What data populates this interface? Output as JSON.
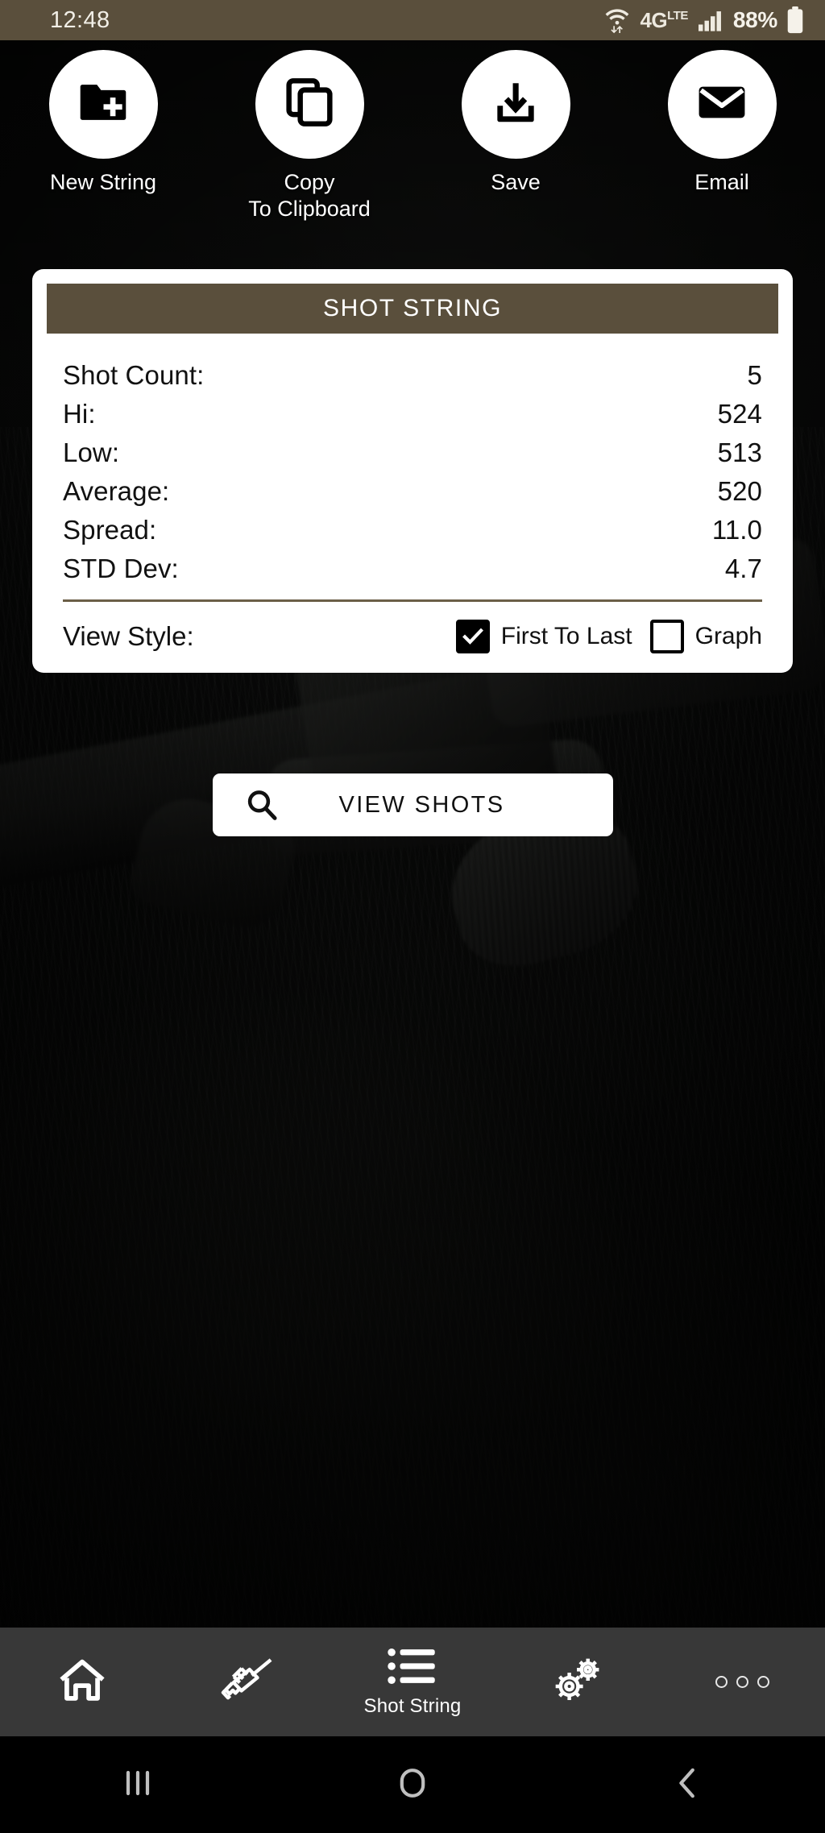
{
  "status_bar": {
    "time": "12:48",
    "wifi_icon": "wifi-with-transfer-arrows-icon",
    "network_label": "4G",
    "network_suffix": "LTE",
    "signal_icon": "signal-bars-icon",
    "battery_percent": "88%",
    "battery_icon": "battery-icon",
    "background_color": "#5A4F3C"
  },
  "actions": [
    {
      "label": "New String",
      "icon": "folder-plus-icon"
    },
    {
      "label": "Copy\nTo Clipboard",
      "label_line1": "Copy",
      "label_line2": "To Clipboard",
      "icon": "copy-icon"
    },
    {
      "label": "Save",
      "icon": "download-icon"
    },
    {
      "label": "Email",
      "icon": "envelope-icon"
    }
  ],
  "card": {
    "header_title": "SHOT STRING",
    "header_color": "#5A4F3C",
    "stats": [
      {
        "key": "Shot Count:",
        "value": "5"
      },
      {
        "key": "Hi:",
        "value": "524"
      },
      {
        "key": "Low:",
        "value": "513"
      },
      {
        "key": "Average:",
        "value": "520"
      },
      {
        "key": "Spread:",
        "value": "11.0"
      },
      {
        "key": "STD Dev:",
        "value": "4.7"
      }
    ],
    "view_style": {
      "label": "View Style:",
      "options": [
        {
          "label": "First To Last",
          "checked": true
        },
        {
          "label": "Graph",
          "checked": false
        }
      ]
    }
  },
  "view_shots_button": {
    "label": "VIEW SHOTS",
    "icon": "search-icon"
  },
  "bottom_nav": {
    "background_color": "#383838",
    "items": [
      {
        "label": "",
        "icon": "home-icon",
        "active": false
      },
      {
        "label": "",
        "icon": "rifle-icon",
        "active": false
      },
      {
        "label": "Shot String",
        "icon": "list-icon",
        "active": true
      },
      {
        "label": "",
        "icon": "gears-icon",
        "active": false
      },
      {
        "label": "",
        "icon": "more-dots-icon",
        "active": false
      }
    ]
  },
  "system_nav": {
    "recents_icon": "recents-bars-icon",
    "home_icon": "home-circle-icon",
    "back_icon": "back-chevron-icon"
  }
}
